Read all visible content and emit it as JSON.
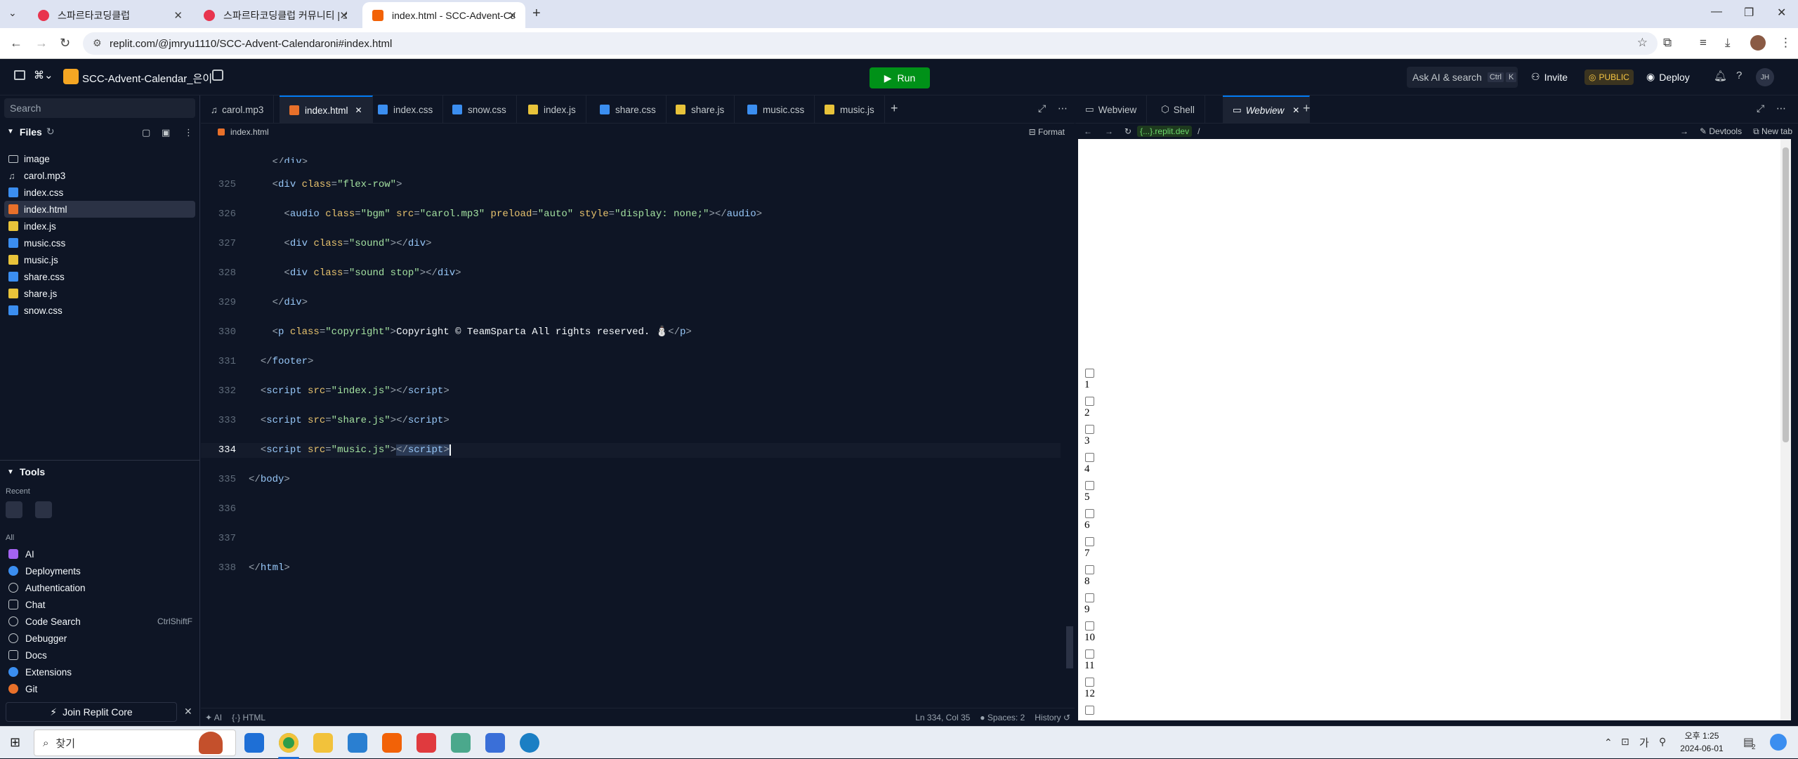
{
  "browser": {
    "tabs": [
      {
        "title": "스파르타코딩클럽"
      },
      {
        "title": "스파르타코딩클럽 커뮤니티 | 스"
      },
      {
        "title": "index.html - SCC-Advent-Cale"
      }
    ],
    "url": "replit.com/@jmryu1110/SCC-Advent-Calendaroni#index.html"
  },
  "replit": {
    "project_name": "SCC-Advent-Calendar_은이",
    "run_label": "Run",
    "search_label": "Ask AI & search",
    "shortcut_ctrl": "Ctrl",
    "shortcut_k": "K",
    "invite_label": "Invite",
    "public_label": "PUBLIC",
    "deploy_label": "Deploy",
    "user_initials": "JH"
  },
  "sidebar": {
    "search_placeholder": "Search",
    "files_label": "Files",
    "files": [
      "image",
      "carol.mp3",
      "index.css",
      "index.html",
      "index.js",
      "music.css",
      "music.js",
      "share.css",
      "share.js",
      "snow.css"
    ],
    "tools_label": "Tools",
    "recent_label": "Recent",
    "all_label": "All",
    "tools": [
      "AI",
      "Deployments",
      "Authentication",
      "Chat",
      "Code Search",
      "Debugger",
      "Docs",
      "Extensions",
      "Git"
    ],
    "code_search_shortcut": "CtrlShiftF",
    "join_label": "Join Replit Core"
  },
  "editor": {
    "tabs": [
      "carol.mp3",
      "index.html",
      "index.css",
      "snow.css",
      "index.js",
      "share.css",
      "share.js",
      "music.css",
      "music.js"
    ],
    "breadcrumb": "index.html",
    "format_label": "Format",
    "status": {
      "ai": "AI",
      "lang": "HTML",
      "position": "Ln 334, Col 35",
      "spaces": "Spaces: 2",
      "history": "History"
    }
  },
  "right_pane": {
    "tabs": [
      "Webview",
      "Shell",
      "Webview"
    ],
    "url_host": "{...}.replit.dev",
    "url_path": "/",
    "devtools_label": "Devtools",
    "newtab_label": "New tab",
    "checkbox_labels": [
      "1",
      "2",
      "3",
      "4",
      "5",
      "6",
      "7",
      "8",
      "9",
      "10",
      "11",
      "12"
    ]
  },
  "taskbar": {
    "search_placeholder": "찾기",
    "ime": "가",
    "time": "오후 1:25",
    "date": "2024-06-01",
    "notif_count": "2"
  }
}
